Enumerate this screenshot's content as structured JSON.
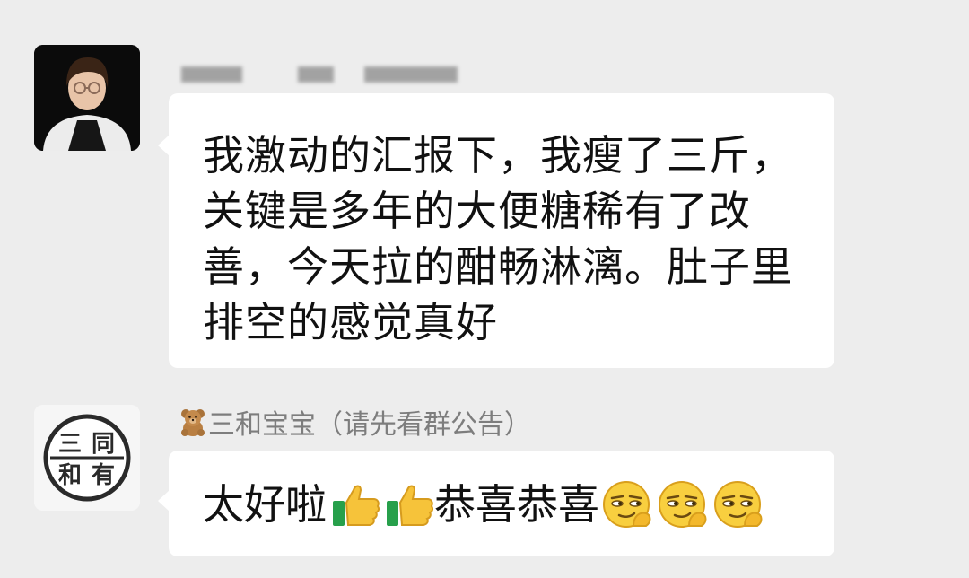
{
  "messages": [
    {
      "avatar": "user-photo-avatar",
      "text": "我激动的汇报下，我瘦了三斤，关键是多年的大便糖稀有了改善，今天拉的酣畅淋漓。肚子里排空的感觉真好"
    },
    {
      "avatar": "sanhe-logo-avatar",
      "sender_icon": "teddy-bear-icon",
      "sender_name": "三和宝宝（请先看群公告）",
      "text_part1": "太好啦",
      "text_part2": "恭喜恭喜",
      "icons": [
        "thumbs-up-icon",
        "thumbs-up-icon",
        "smirk-face-icon",
        "smirk-face-icon",
        "smirk-face-icon"
      ],
      "logo_text": "三同和有"
    }
  ],
  "colors": {
    "background": "#ededed",
    "bubble": "#ffffff",
    "name": "#7d7d7d",
    "text": "#111111"
  }
}
